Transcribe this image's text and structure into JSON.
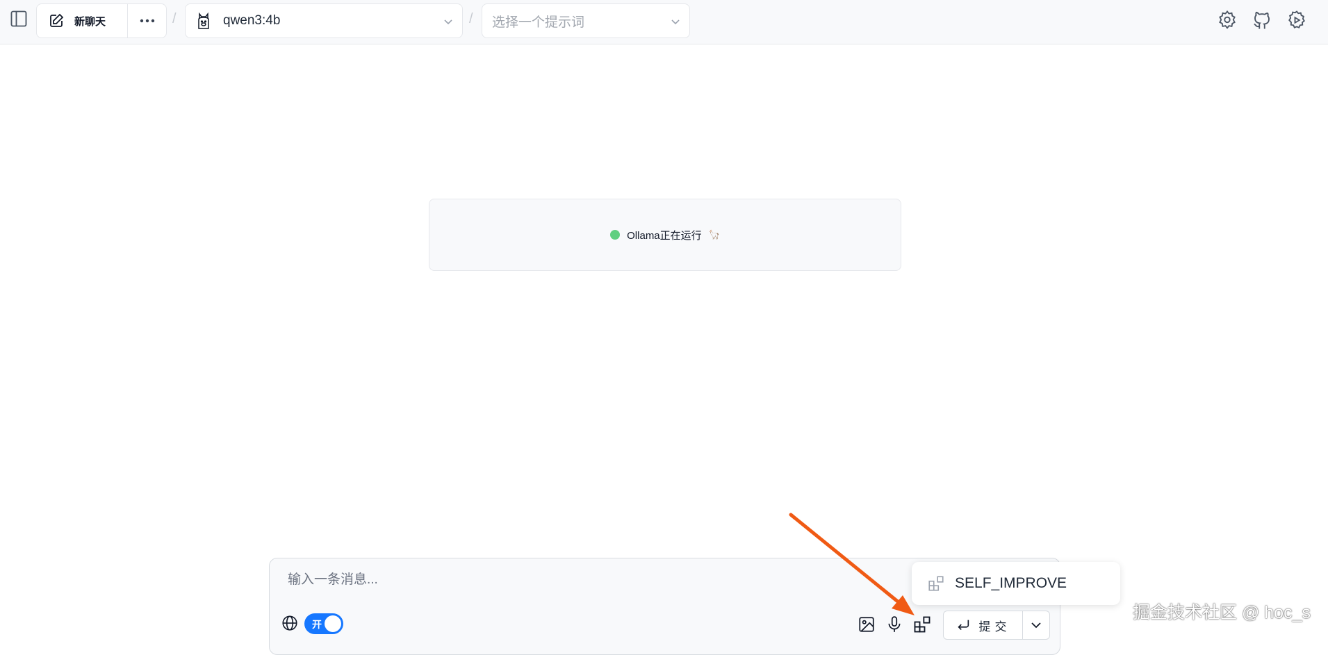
{
  "header": {
    "new_chat_label": "新聊天",
    "separator": "/",
    "model": "qwen3:4b",
    "prompt_placeholder": "选择一个提示词"
  },
  "status": {
    "text": "Ollama正在运行",
    "emoji": "🦙",
    "dot_color": "#5fcf80"
  },
  "composer": {
    "placeholder": "输入一条消息...",
    "toggle_label": "开",
    "toggle_on": true,
    "submit_label": "提交"
  },
  "popup": {
    "item_label": "SELF_IMPROVE"
  },
  "annotation": {
    "arrow_color": "#f05a14"
  },
  "watermark": "掘金技术社区 @ hoc_s",
  "icons": [
    "sidebar-icon",
    "edit-icon",
    "more-icon",
    "llama-icon",
    "chevron-down-icon",
    "settings-icon",
    "github-icon",
    "gear-play-icon",
    "globe-icon",
    "image-icon",
    "microphone-icon",
    "apps-icon",
    "enter-icon"
  ]
}
